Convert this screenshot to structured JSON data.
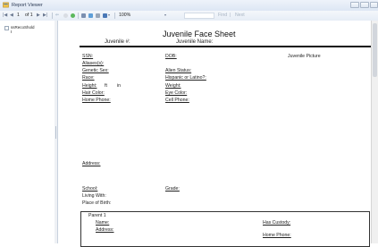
{
  "window": {
    "title": "Report Viewer"
  },
  "toolbar": {
    "first": "|◀",
    "prev": "◀",
    "page_current": "1",
    "page_of": "of 1",
    "next": "▶",
    "last": "▶|",
    "zoom_value": "100%",
    "find_label": "Find",
    "separator": "|",
    "next_label": "Next"
  },
  "doc_map": {
    "items": [
      "ssRecoShold"
    ]
  },
  "report": {
    "title": "Juvenile Face Sheet",
    "header_col1": "Juvenile #:",
    "header_col2": "Juvenile Name:",
    "fields_left": [
      "SSN:",
      "Aliases(s):",
      "Genetic Sex:",
      "Race:",
      "Height:",
      "Hair Color:",
      "Home Phone:"
    ],
    "height_ft": "ft",
    "height_in": "in",
    "fields_mid": [
      "DOB:",
      "Alien Status:",
      "Hispanic or Latino?:",
      "Weight:",
      "Eye Color:",
      "Cell Phone:"
    ],
    "picture_label": "Juvenile Picture",
    "address_label": "Address:",
    "school_label": "School:",
    "grade_label": "Grade:",
    "living_with": "Living With:",
    "place_of_birth": "Place of Birth:",
    "parent_title": "Parent 1",
    "parent_name": "Name:",
    "parent_address": "Address:",
    "has_custody": "Has Custody:",
    "parent_home_phone": "Home Phone:"
  },
  "colors": {
    "titlebar": "#dde7f4",
    "toolbar": "#e6edf6",
    "accent": "#2b3a55"
  }
}
